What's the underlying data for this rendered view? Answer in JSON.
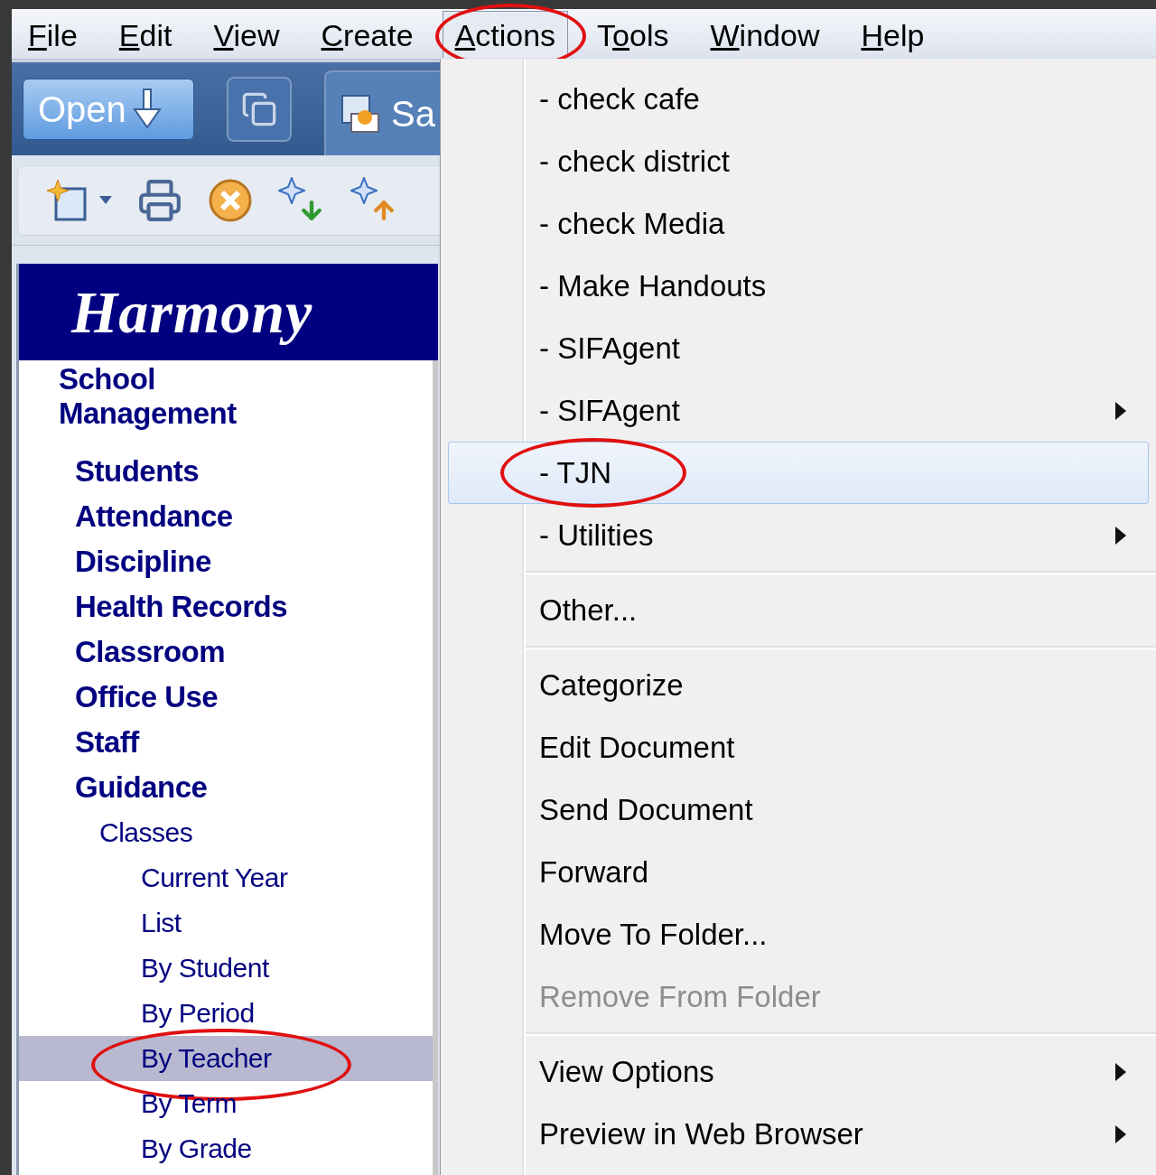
{
  "menu_bar": [
    {
      "access_key": "F",
      "rest": "ile",
      "open": false,
      "circled": false
    },
    {
      "access_key": "E",
      "rest": "dit",
      "open": false,
      "circled": false
    },
    {
      "access_key": "V",
      "rest": "iew",
      "open": false,
      "circled": false
    },
    {
      "access_key": "C",
      "rest": "reate",
      "open": false,
      "circled": false
    },
    {
      "access_key": "A",
      "rest": "ctions",
      "open": true,
      "circled": true
    },
    {
      "lead": "T",
      "access_key": "o",
      "rest": "ols",
      "open": false,
      "circled": false
    },
    {
      "access_key": "W",
      "rest": "indow",
      "open": false,
      "circled": false
    },
    {
      "access_key": "H",
      "rest": "elp",
      "open": false,
      "circled": false
    }
  ],
  "toolbar": {
    "open_button": "Open",
    "tab_label": "Sa"
  },
  "sidebar": {
    "logo_text": "Harmony",
    "title": "School Management",
    "items": [
      {
        "label": "Students",
        "selected": false
      },
      {
        "label": "Attendance",
        "selected": false
      },
      {
        "label": "Discipline",
        "selected": false
      },
      {
        "label": "Health Records",
        "selected": false
      },
      {
        "label": "Classroom",
        "selected": false
      },
      {
        "label": "Office Use",
        "selected": false
      },
      {
        "label": "Staff",
        "selected": false
      },
      {
        "label": "Guidance",
        "selected": false,
        "children": [
          {
            "label": "Classes",
            "selected": false,
            "children": [
              {
                "label": "Current Year",
                "selected": false,
                "circled": false
              },
              {
                "label": "List",
                "selected": false,
                "circled": false
              },
              {
                "label": "By Student",
                "selected": false,
                "circled": false
              },
              {
                "label": "By Period",
                "selected": false,
                "circled": false
              },
              {
                "label": "By Teacher",
                "selected": true,
                "circled": true
              },
              {
                "label": "By Term",
                "selected": false,
                "circled": false
              },
              {
                "label": "By Grade",
                "selected": false,
                "circled": false
              }
            ]
          }
        ]
      }
    ]
  },
  "actions_menu": {
    "sections": [
      [
        {
          "label": "- check cafe",
          "selected": false,
          "submenu": false,
          "disabled": false,
          "circled": false
        },
        {
          "label": "- check district",
          "selected": false,
          "submenu": false,
          "disabled": false,
          "circled": false
        },
        {
          "label": "- check Media",
          "selected": false,
          "submenu": false,
          "disabled": false,
          "circled": false
        },
        {
          "label": "- Make Handouts",
          "selected": false,
          "submenu": false,
          "disabled": false,
          "circled": false
        },
        {
          "label": "- SIFAgent",
          "selected": false,
          "submenu": false,
          "disabled": false,
          "circled": false
        },
        {
          "label": "- SIFAgent",
          "selected": false,
          "submenu": true,
          "disabled": false,
          "circled": false
        },
        {
          "label": "- TJN",
          "selected": true,
          "submenu": false,
          "disabled": false,
          "circled": true
        },
        {
          "label": "- Utilities",
          "selected": false,
          "submenu": true,
          "disabled": false,
          "circled": false
        }
      ],
      [
        {
          "label": "Other...",
          "selected": false,
          "submenu": false,
          "disabled": false,
          "circled": false
        }
      ],
      [
        {
          "label": "Categorize",
          "selected": false,
          "submenu": false,
          "disabled": false,
          "circled": false
        },
        {
          "label": "Edit Document",
          "selected": false,
          "submenu": false,
          "disabled": false,
          "circled": false
        },
        {
          "label": "Send Document",
          "selected": false,
          "submenu": false,
          "disabled": false,
          "circled": false
        },
        {
          "label": "Forward",
          "selected": false,
          "submenu": false,
          "disabled": false,
          "circled": false
        },
        {
          "label": "Move To Folder...",
          "selected": false,
          "submenu": false,
          "disabled": false,
          "circled": false
        },
        {
          "label": "Remove From Folder",
          "selected": false,
          "submenu": false,
          "disabled": true,
          "circled": false
        }
      ],
      [
        {
          "label": "View Options",
          "selected": false,
          "submenu": true,
          "disabled": false,
          "circled": false
        },
        {
          "label": "Preview in Web Browser",
          "selected": false,
          "submenu": true,
          "disabled": false,
          "circled": false
        }
      ]
    ]
  }
}
